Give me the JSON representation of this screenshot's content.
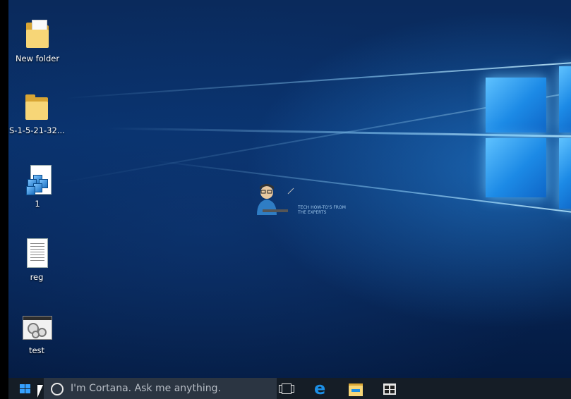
{
  "desktop": {
    "icons": [
      {
        "label": "New folder",
        "type": "folder-with-files"
      },
      {
        "label": "S-1-5-21-32...",
        "type": "folder"
      },
      {
        "label": "1",
        "type": "registry-file"
      },
      {
        "label": "reg",
        "type": "text-document"
      },
      {
        "label": "test",
        "type": "application-window"
      }
    ],
    "watermark": {
      "text": "TECH HOW-TO'S FROM\nTHE EXPERTS"
    }
  },
  "taskbar": {
    "start_icon": "windows-logo-icon",
    "cortana_placeholder": "I'm Cortana. Ask me anything.",
    "pinned": [
      {
        "name": "task-view-icon"
      },
      {
        "name": "edge-icon"
      },
      {
        "name": "file-explorer-icon"
      },
      {
        "name": "store-icon"
      }
    ]
  },
  "colors": {
    "accent": "#35a0ff",
    "taskbar": "#151d26",
    "search_box": "#2b3542"
  }
}
